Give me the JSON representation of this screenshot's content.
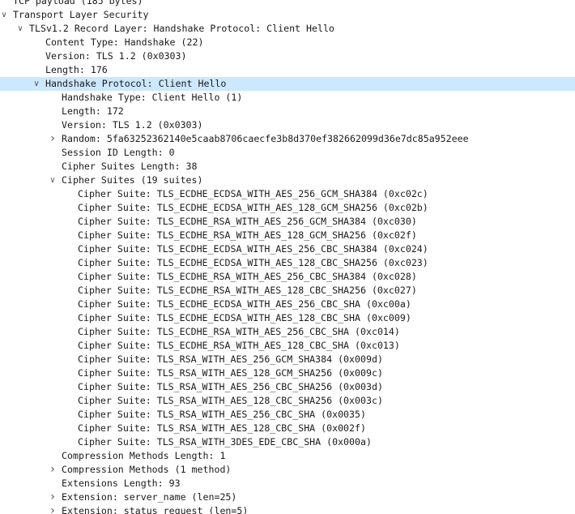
{
  "window": {
    "title": "",
    "selected_row": 6
  },
  "packet_details": {
    "rows": [
      {
        "level": 0,
        "text": "TCP payload (185 bytes)",
        "toggle": "",
        "partial": true
      },
      {
        "level": 0,
        "text": "Transport Layer Security",
        "toggle": "expanded"
      },
      {
        "level": 1,
        "text": "TLSv1.2 Record Layer: Handshake Protocol: Client Hello",
        "toggle": "expanded"
      },
      {
        "level": 2,
        "text": "Content Type: Handshake (22)",
        "toggle": ""
      },
      {
        "level": 2,
        "text": "Version: TLS 1.2 (0x0303)",
        "toggle": ""
      },
      {
        "level": 2,
        "text": "Length: 176",
        "toggle": ""
      },
      {
        "level": 2,
        "text": "Handshake Protocol: Client Hello",
        "toggle": "expanded"
      },
      {
        "level": 3,
        "text": "Handshake Type: Client Hello (1)",
        "toggle": ""
      },
      {
        "level": 3,
        "text": "Length: 172",
        "toggle": ""
      },
      {
        "level": 3,
        "text": "Version: TLS 1.2 (0x0303)",
        "toggle": ""
      },
      {
        "level": 3,
        "text": "Random: 5fa63252362140e5caab8706caecfe3b8d370ef382662099d36e7dc85a952eee",
        "toggle": "collapsed"
      },
      {
        "level": 3,
        "text": "Session ID Length: 0",
        "toggle": ""
      },
      {
        "level": 3,
        "text": "Cipher Suites Length: 38",
        "toggle": ""
      },
      {
        "level": 3,
        "text": "Cipher Suites (19 suites)",
        "toggle": "expanded"
      },
      {
        "level": 4,
        "text": "Cipher Suite: TLS_ECDHE_ECDSA_WITH_AES_256_GCM_SHA384 (0xc02c)",
        "toggle": ""
      },
      {
        "level": 4,
        "text": "Cipher Suite: TLS_ECDHE_ECDSA_WITH_AES_128_GCM_SHA256 (0xc02b)",
        "toggle": ""
      },
      {
        "level": 4,
        "text": "Cipher Suite: TLS_ECDHE_RSA_WITH_AES_256_GCM_SHA384 (0xc030)",
        "toggle": ""
      },
      {
        "level": 4,
        "text": "Cipher Suite: TLS_ECDHE_RSA_WITH_AES_128_GCM_SHA256 (0xc02f)",
        "toggle": ""
      },
      {
        "level": 4,
        "text": "Cipher Suite: TLS_ECDHE_ECDSA_WITH_AES_256_CBC_SHA384 (0xc024)",
        "toggle": ""
      },
      {
        "level": 4,
        "text": "Cipher Suite: TLS_ECDHE_ECDSA_WITH_AES_128_CBC_SHA256 (0xc023)",
        "toggle": ""
      },
      {
        "level": 4,
        "text": "Cipher Suite: TLS_ECDHE_RSA_WITH_AES_256_CBC_SHA384 (0xc028)",
        "toggle": ""
      },
      {
        "level": 4,
        "text": "Cipher Suite: TLS_ECDHE_RSA_WITH_AES_128_CBC_SHA256 (0xc027)",
        "toggle": ""
      },
      {
        "level": 4,
        "text": "Cipher Suite: TLS_ECDHE_ECDSA_WITH_AES_256_CBC_SHA (0xc00a)",
        "toggle": ""
      },
      {
        "level": 4,
        "text": "Cipher Suite: TLS_ECDHE_ECDSA_WITH_AES_128_CBC_SHA (0xc009)",
        "toggle": ""
      },
      {
        "level": 4,
        "text": "Cipher Suite: TLS_ECDHE_RSA_WITH_AES_256_CBC_SHA (0xc014)",
        "toggle": ""
      },
      {
        "level": 4,
        "text": "Cipher Suite: TLS_ECDHE_RSA_WITH_AES_128_CBC_SHA (0xc013)",
        "toggle": ""
      },
      {
        "level": 4,
        "text": "Cipher Suite: TLS_RSA_WITH_AES_256_GCM_SHA384 (0x009d)",
        "toggle": ""
      },
      {
        "level": 4,
        "text": "Cipher Suite: TLS_RSA_WITH_AES_128_GCM_SHA256 (0x009c)",
        "toggle": ""
      },
      {
        "level": 4,
        "text": "Cipher Suite: TLS_RSA_WITH_AES_256_CBC_SHA256 (0x003d)",
        "toggle": ""
      },
      {
        "level": 4,
        "text": "Cipher Suite: TLS_RSA_WITH_AES_128_CBC_SHA256 (0x003c)",
        "toggle": ""
      },
      {
        "level": 4,
        "text": "Cipher Suite: TLS_RSA_WITH_AES_256_CBC_SHA (0x0035)",
        "toggle": ""
      },
      {
        "level": 4,
        "text": "Cipher Suite: TLS_RSA_WITH_AES_128_CBC_SHA (0x002f)",
        "toggle": ""
      },
      {
        "level": 4,
        "text": "Cipher Suite: TLS_RSA_WITH_3DES_EDE_CBC_SHA (0x000a)",
        "toggle": ""
      },
      {
        "level": 3,
        "text": "Compression Methods Length: 1",
        "toggle": ""
      },
      {
        "level": 3,
        "text": "Compression Methods (1 method)",
        "toggle": "collapsed"
      },
      {
        "level": 3,
        "text": "Extensions Length: 93",
        "toggle": ""
      },
      {
        "level": 3,
        "text": "Extension: server_name (len=25)",
        "toggle": "collapsed"
      },
      {
        "level": 3,
        "text": "Extension: status_request (len=5)",
        "toggle": "collapsed"
      }
    ]
  },
  "icons": {
    "expanded": "chevron-down-icon",
    "collapsed": "chevron-right-icon"
  },
  "colors": {
    "selection": "#cce8ff",
    "text": "#1a1a1a",
    "toggle": "#555555"
  }
}
